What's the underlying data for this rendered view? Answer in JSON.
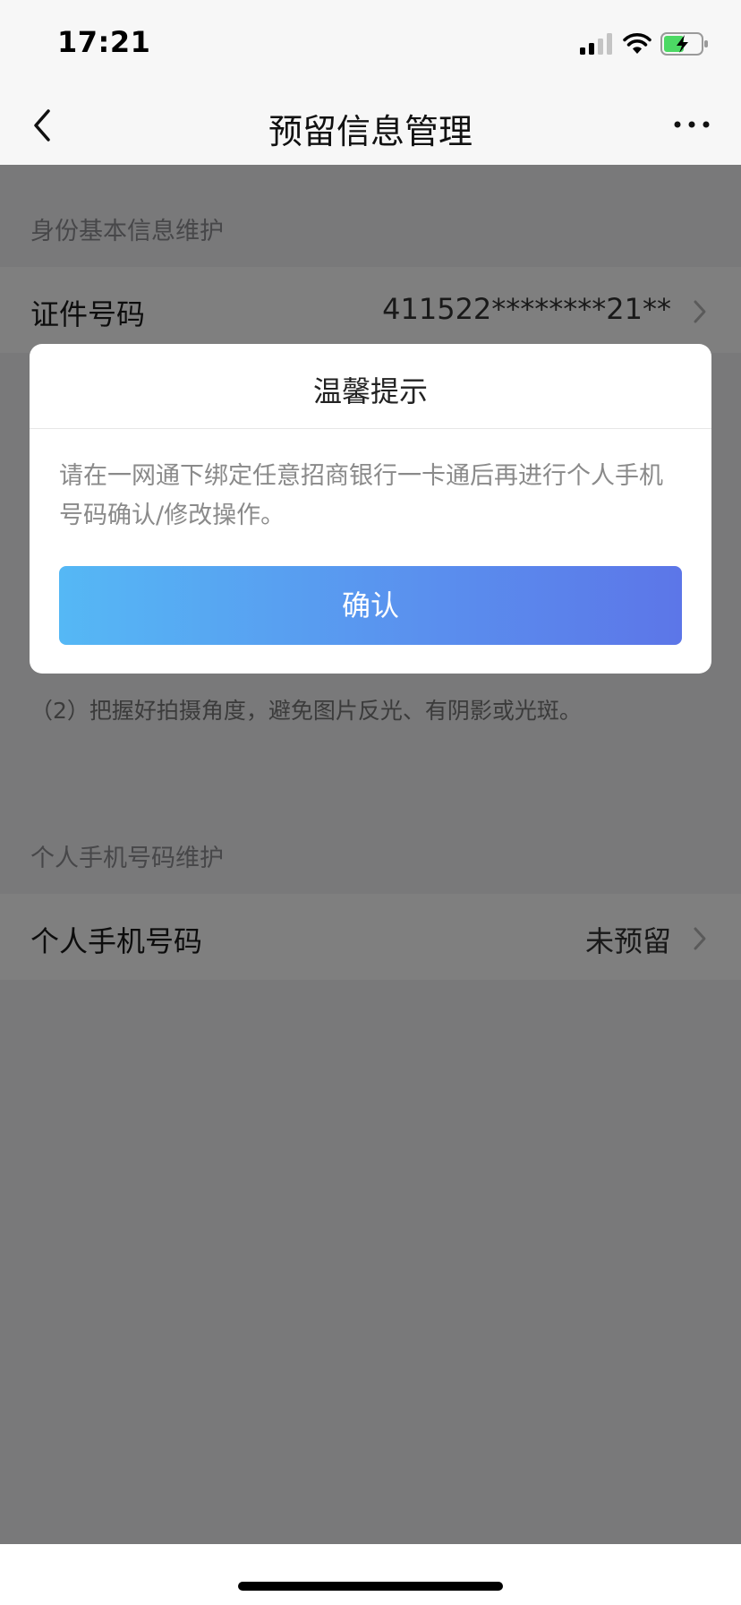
{
  "status_bar": {
    "time": "17:21"
  },
  "nav": {
    "title": "预留信息管理"
  },
  "identity_section": {
    "header": "身份基本信息维护",
    "row": {
      "label": "证件号码",
      "value": "411522********21**"
    },
    "hint_line_2": "（2）把握好拍摄角度，避免图片反光、有阴影或光斑。"
  },
  "phone_section": {
    "header": "个人手机号码维护",
    "row": {
      "label": "个人手机号码",
      "value": "未预留"
    }
  },
  "dialog": {
    "title": "温馨提示",
    "message": "请在一网通下绑定任意招商银行一卡通后再进行个人手机号码确认/修改操作。",
    "confirm_label": "确认"
  },
  "colors": {
    "accent_gradient_start": "#55b8f5",
    "accent_gradient_end": "#5c76e8",
    "battery_charging": "#4cd964"
  }
}
